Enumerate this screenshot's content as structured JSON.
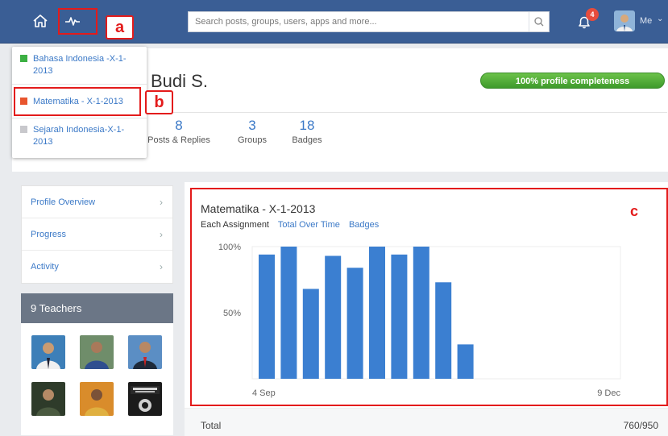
{
  "topbar": {
    "search_placeholder": "Search posts, groups, users, apps and more...",
    "notification_count": "4",
    "me_label": "Me"
  },
  "dropdown": {
    "items": [
      {
        "label": "Bahasa Indonesia -X-1-2013",
        "color": "#3cb043"
      },
      {
        "label": "Matematika - X-1-2013",
        "color": "#e8552e"
      },
      {
        "label": "Sejarah Indonesia-X-1-2013",
        "color": "#c8c8cc"
      }
    ]
  },
  "profile": {
    "name": "Budi S.",
    "completeness": "100% profile completeness",
    "stats": [
      {
        "num": "8",
        "label": "Posts & Replies"
      },
      {
        "num": "3",
        "label": "Groups"
      },
      {
        "num": "18",
        "label": "Badges"
      }
    ]
  },
  "sidebar": {
    "items": [
      {
        "label": "Profile Overview"
      },
      {
        "label": "Progress"
      },
      {
        "label": "Activity"
      }
    ],
    "teachers_title": "9 Teachers"
  },
  "main": {
    "title": "Matematika - X-1-2013",
    "tabs": [
      "Each Assignment",
      "Total Over Time",
      "Badges"
    ],
    "total_label": "Total",
    "total_value": "760/950"
  },
  "annotations": {
    "a": "a",
    "b": "b",
    "c": "c"
  },
  "chart_data": {
    "type": "bar",
    "categories": [
      "1",
      "2",
      "3",
      "4",
      "5",
      "6",
      "7",
      "8",
      "9",
      "10"
    ],
    "values": [
      94,
      100,
      68,
      93,
      84,
      100,
      94,
      100,
      73,
      26
    ],
    "ytick_labels": [
      "100%",
      "50%"
    ],
    "x_start_label": "4 Sep",
    "x_end_label": "9 Dec",
    "ylim": [
      0,
      100
    ],
    "bar_color": "#3b7fd1"
  }
}
